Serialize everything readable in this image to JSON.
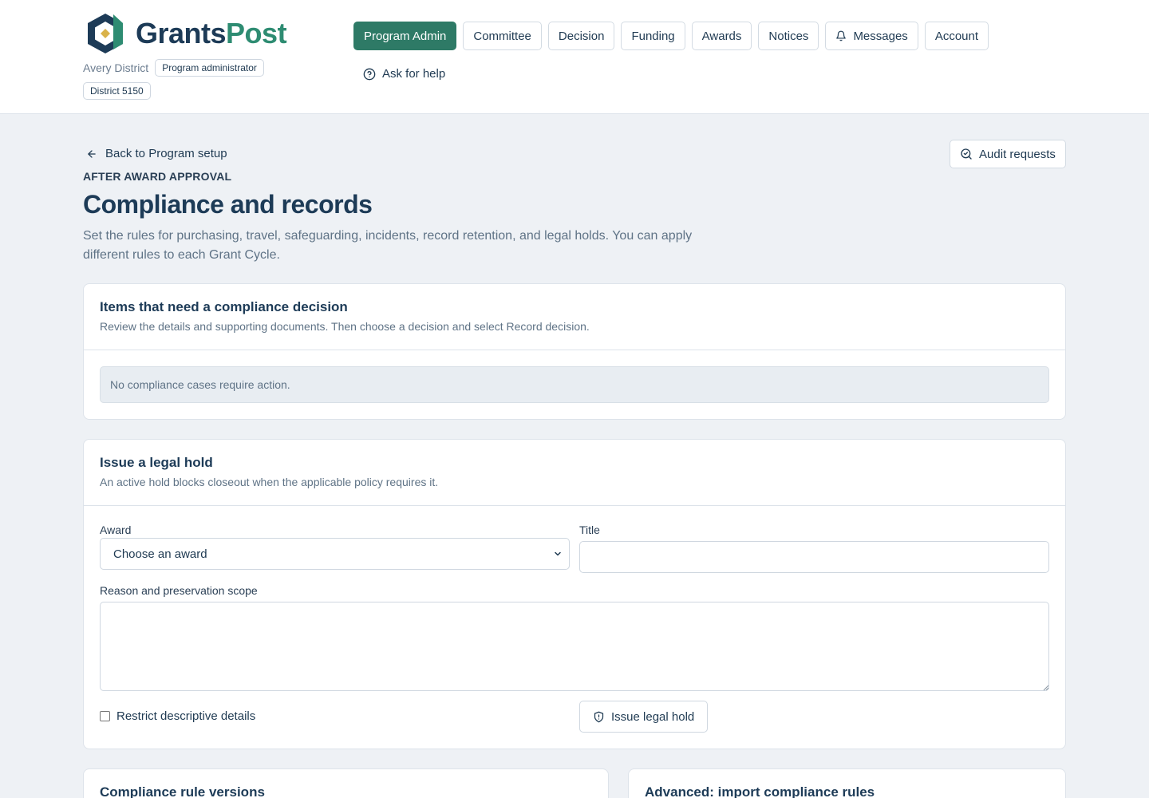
{
  "brand": {
    "name_part1": "Grants",
    "name_part2": "Post",
    "color_primary": "#1d3b57",
    "color_accent": "#2e8c72"
  },
  "org": {
    "name": "Avery District",
    "role": "Program administrator",
    "district": "District 5150"
  },
  "nav": {
    "items": [
      {
        "label": "Program Admin",
        "active": true
      },
      {
        "label": "Committee"
      },
      {
        "label": "Decision"
      },
      {
        "label": "Funding"
      },
      {
        "label": "Awards"
      },
      {
        "label": "Notices"
      },
      {
        "label": "Messages",
        "icon": "bell-icon"
      },
      {
        "label": "Account"
      }
    ],
    "help_label": "Ask for help"
  },
  "page": {
    "back_label": "Back to Program setup",
    "audit_label": "Audit requests",
    "eyebrow": "AFTER AWARD APPROVAL",
    "title": "Compliance and records",
    "description": "Set the rules for purchasing, travel, safeguarding, incidents, record retention, and legal holds. You can apply different rules to each Grant Cycle."
  },
  "decisions_card": {
    "title": "Items that need a compliance decision",
    "subtitle": "Review the details and supporting documents. Then choose a decision and select Record decision.",
    "empty_text": "No compliance cases require action."
  },
  "legal_hold_card": {
    "title": "Issue a legal hold",
    "subtitle": "An active hold blocks closeout when the applicable policy requires it.",
    "award_label": "Award",
    "award_selected": "Choose an award",
    "title_label": "Title",
    "title_value": "",
    "reason_label": "Reason and preservation scope",
    "reason_value": "",
    "restrict_label": "Restrict descriptive details",
    "restrict_checked": false,
    "issue_label": "Issue legal hold"
  },
  "bottom_cards": {
    "versions_title": "Compliance rule versions",
    "import_title": "Advanced: import compliance rules"
  }
}
